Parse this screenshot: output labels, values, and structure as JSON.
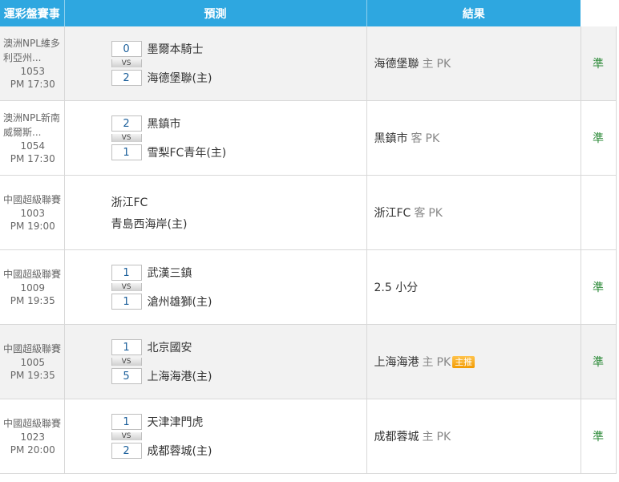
{
  "header": {
    "col1": "運彩盤賽事",
    "col2": "預測",
    "col3": "結果"
  },
  "vs_label": "VS",
  "rows": [
    {
      "league": "澳洲NPL維多利亞州...",
      "code": "1053",
      "time": "PM 17:30",
      "away_score": "0",
      "away": "墨爾本騎士",
      "home_score": "2",
      "home": "海德堡聯(主)",
      "pred_team": "海德堡聯",
      "pred_side": "主",
      "pred_pk": "PK",
      "badge": "",
      "result": "準"
    },
    {
      "league": "澳洲NPL新南威爾斯...",
      "code": "1054",
      "time": "PM 17:30",
      "away_score": "2",
      "away": "黑鎮市",
      "home_score": "1",
      "home": "雪梨FC青年(主)",
      "pred_team": "黑鎮市",
      "pred_side": "客",
      "pred_pk": "PK",
      "badge": "",
      "result": "準"
    },
    {
      "league": "中國超級聯賽",
      "code": "1003",
      "time": "PM 19:00",
      "away_score": "",
      "away": "浙江FC",
      "home_score": "",
      "home": "青島西海岸(主)",
      "pred_team": "浙江FC",
      "pred_side": "客",
      "pred_pk": "PK",
      "badge": "",
      "result": ""
    },
    {
      "league": "中國超級聯賽",
      "code": "1009",
      "time": "PM 19:35",
      "away_score": "1",
      "away": "武漢三鎮",
      "home_score": "1",
      "home": "滄州雄獅(主)",
      "pred_team": "2.5 小分",
      "pred_side": "",
      "pred_pk": "",
      "badge": "",
      "result": "準"
    },
    {
      "league": "中國超級聯賽",
      "code": "1005",
      "time": "PM 19:35",
      "away_score": "1",
      "away": "北京國安",
      "home_score": "5",
      "home": "上海海港(主)",
      "pred_team": "上海海港",
      "pred_side": "主",
      "pred_pk": "PK",
      "badge": "主推",
      "result": "準"
    },
    {
      "league": "中國超級聯賽",
      "code": "1023",
      "time": "PM 20:00",
      "away_score": "1",
      "away": "天津津門虎",
      "home_score": "2",
      "home": "成都蓉城(主)",
      "pred_team": "成都蓉城",
      "pred_side": "主",
      "pred_pk": "PK",
      "badge": "",
      "result": "準"
    }
  ]
}
